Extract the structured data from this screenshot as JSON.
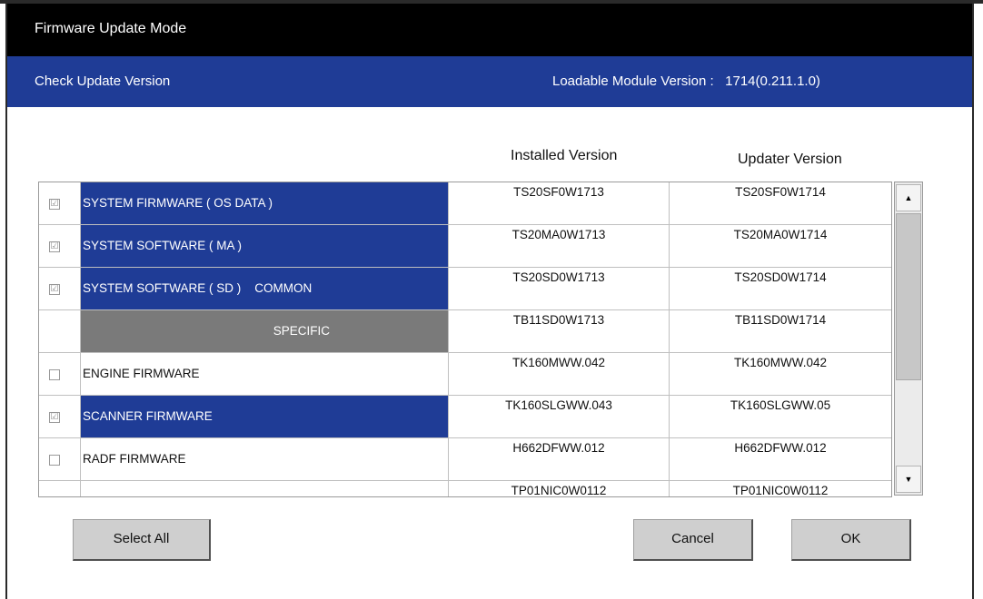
{
  "window": {
    "title": "Firmware Update Mode"
  },
  "header": {
    "left_label": "Check Update Version",
    "right_label": "Loadable Module Version :   1714(0.211.1.0)"
  },
  "columns": {
    "installed": "Installed Version",
    "updater": "Updater Version"
  },
  "rows": [
    {
      "name": "SYSTEM FIRMWARE ( OS DATA )",
      "installed": "TS20SF0W1713",
      "updater": "TS20SF0W1714",
      "checked": "☑"
    },
    {
      "name": "SYSTEM SOFTWARE ( MA )",
      "installed": "TS20MA0W1713",
      "updater": "TS20MA0W1714",
      "checked": "☑"
    },
    {
      "name": "SYSTEM SOFTWARE ( SD )    COMMON",
      "installed": "TS20SD0W1713",
      "updater": "TS20SD0W1714",
      "checked": "☑"
    },
    {
      "name": "SPECIFIC",
      "installed": "TB11SD0W1713",
      "updater": "TB11SD0W1714",
      "checked": ""
    },
    {
      "name": "ENGINE FIRMWARE",
      "installed": "TK160MWW.042",
      "updater": "TK160MWW.042",
      "checked": ""
    },
    {
      "name": "SCANNER FIRMWARE",
      "installed": "TK160SLGWW.043",
      "updater": "TK160SLGWW.05",
      "checked": "☑"
    },
    {
      "name": "RADF FIRMWARE",
      "installed": "H662DFWW.012",
      "updater": "H662DFWW.012",
      "checked": ""
    },
    {
      "name": "",
      "installed": "TP01NIC0W0112",
      "updater": "TP01NIC0W0112",
      "checked": ""
    }
  ],
  "scrollbar": {
    "up_icon": "▲",
    "down_icon": "▼"
  },
  "buttons": {
    "select_all": "Select All",
    "cancel": "Cancel",
    "ok": "OK"
  },
  "colors": {
    "title_bg": "#000000",
    "header_bg": "#1f3c96",
    "selected_row": "#1f3c96",
    "specific_row": "#7a7a7a",
    "button_bg": "#cfcfcf"
  }
}
